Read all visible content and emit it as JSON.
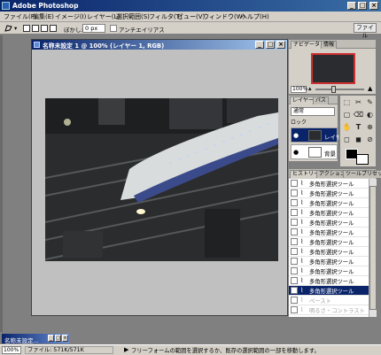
{
  "app": {
    "title": "Adobe Photoshop",
    "window_buttons": [
      "_",
      "□",
      "×"
    ]
  },
  "menu": {
    "items": [
      "ファイル(F)",
      "編集(E)",
      "イメージ(I)",
      "レイヤー(L)",
      "選択範囲(S)",
      "フィルタ(T)",
      "ビュー(V)",
      "ウィンドウ(W)",
      "ヘルプ(H)"
    ]
  },
  "options": {
    "feather_label": "ぼかし:",
    "feather_value": "0 px",
    "antialias_label": "アンチエイリアス",
    "file_browser_label": "ファイル"
  },
  "document": {
    "title": "名称未設定 1 @ 100% (レイヤー 1, RGB)",
    "window_buttons": [
      "_",
      "□",
      "×"
    ]
  },
  "navigator": {
    "tabs": [
      "ナビゲータ",
      "情報"
    ],
    "zoom": "100%"
  },
  "layers": {
    "tabs": [
      "レイヤー",
      "パス"
    ],
    "blend_mode": "通常",
    "lock_label": "ロック",
    "rows": [
      {
        "name": "レイヤ",
        "selected": true
      },
      {
        "name": "背景",
        "selected": false
      }
    ]
  },
  "tools": {
    "icons": [
      "⬚",
      "✂",
      "✎",
      "▢",
      "⌫",
      "◐",
      "✋",
      "T",
      "⊕",
      "◻",
      "◼",
      "⊘"
    ]
  },
  "history": {
    "tabs": [
      "ヒストリー",
      "アクション",
      "ツールプリセット"
    ],
    "items": [
      {
        "label": "多角形選択ツール",
        "state": "normal"
      },
      {
        "label": "多角形選択ツール",
        "state": "normal"
      },
      {
        "label": "多角形選択ツール",
        "state": "normal"
      },
      {
        "label": "多角形選択ツール",
        "state": "normal"
      },
      {
        "label": "多角形選択ツール",
        "state": "normal"
      },
      {
        "label": "多角形選択ツール",
        "state": "normal"
      },
      {
        "label": "多角形選択ツール",
        "state": "normal"
      },
      {
        "label": "多角形選択ツール",
        "state": "normal"
      },
      {
        "label": "多角形選択ツール",
        "state": "normal"
      },
      {
        "label": "多角形選択ツール",
        "state": "normal"
      },
      {
        "label": "多角形選択ツール",
        "state": "normal"
      },
      {
        "label": "多角形選択ツール",
        "state": "selected"
      },
      {
        "label": "ペースト",
        "state": "dim"
      },
      {
        "label": "明るさ・コントラスト",
        "state": "dim"
      }
    ]
  },
  "minimized_doc": {
    "title": "名称未設定..."
  },
  "status": {
    "zoom": "100%",
    "file_info": "ファイル: 571K/571K",
    "message": "フリーフォームの範囲を選択するか、既存の選択範囲の一部を移動します。"
  },
  "colors": {
    "title_active": "#0a246a",
    "panel_bg": "#d4d0c8",
    "workspace": "#808080",
    "nav_frame": "#d03030"
  }
}
